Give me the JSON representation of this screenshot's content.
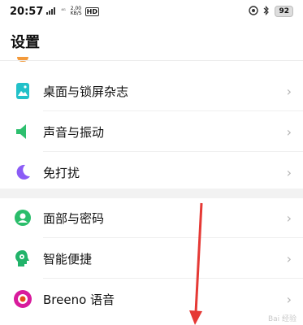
{
  "status": {
    "time": "20:57",
    "network_signal": "⁴ᴳ",
    "speed_value": "2.00",
    "speed_unit": "KB/S",
    "hd": "HD",
    "battery": "92"
  },
  "header": {
    "title": "设置"
  },
  "group1": [
    {
      "label": "桌面与锁屏杂志",
      "icon": "wallpaper-icon",
      "color": "#22c1c9"
    },
    {
      "label": "声音与振动",
      "icon": "speaker-icon",
      "color": "#2dbf6e"
    },
    {
      "label": "免打扰",
      "icon": "moon-icon",
      "color": "#8b5cf6"
    }
  ],
  "group2": [
    {
      "label": "面部与密码",
      "icon": "face-icon",
      "color": "#2bbd6b"
    },
    {
      "label": "智能便捷",
      "icon": "smart-icon",
      "color": "#22b36a"
    },
    {
      "label": "Breeno 语音",
      "icon": "breeno-icon",
      "color": "#d81b9c"
    }
  ],
  "chevron": "›",
  "watermark": "Bai 经验"
}
